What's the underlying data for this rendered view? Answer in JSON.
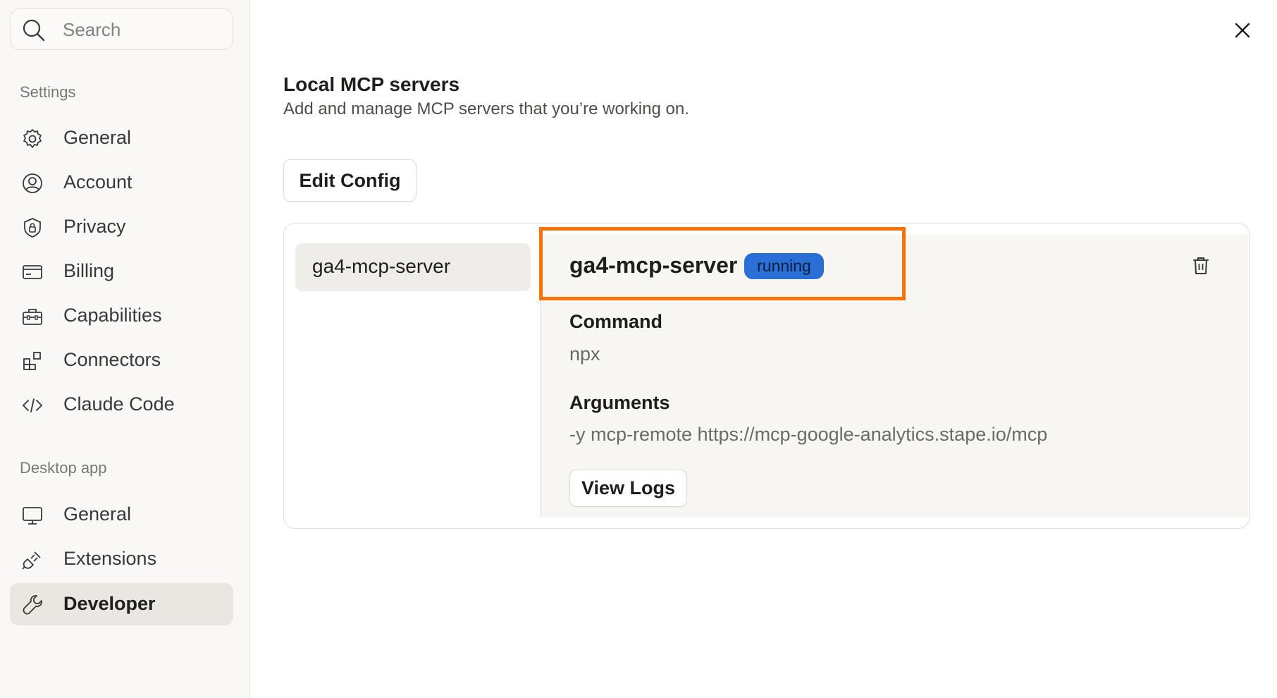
{
  "sidebar": {
    "search_placeholder": "Search",
    "settings_label": "Settings",
    "settings_items": [
      {
        "label": "General",
        "icon": "gear-icon"
      },
      {
        "label": "Account",
        "icon": "user-circle-icon"
      },
      {
        "label": "Privacy",
        "icon": "shield-lock-icon"
      },
      {
        "label": "Billing",
        "icon": "credit-card-icon"
      },
      {
        "label": "Capabilities",
        "icon": "toolbox-icon"
      },
      {
        "label": "Connectors",
        "icon": "blocks-icon"
      },
      {
        "label": "Claude Code",
        "icon": "code-icon"
      }
    ],
    "desktop_label": "Desktop app",
    "desktop_items": [
      {
        "label": "General",
        "icon": "monitor-icon"
      },
      {
        "label": "Extensions",
        "icon": "plug-icon"
      },
      {
        "label": "Developer",
        "icon": "wrench-icon",
        "active": true
      }
    ]
  },
  "main": {
    "title": "Local MCP servers",
    "subtitle": "Add and manage MCP servers that you’re working on.",
    "edit_config_label": "Edit Config",
    "server_list": [
      "ga4-mcp-server"
    ],
    "selected_server": {
      "name": "ga4-mcp-server",
      "status": "running",
      "command_label": "Command",
      "command_value": "npx",
      "arguments_label": "Arguments",
      "arguments_value": "-y mcp-remote https://mcp-google-analytics.stape.io/mcp",
      "view_logs_label": "View Logs"
    }
  },
  "colors": {
    "status_badge": "#2a6fd6",
    "highlight": "#f57308",
    "active_nav": "#e9e7e2"
  }
}
